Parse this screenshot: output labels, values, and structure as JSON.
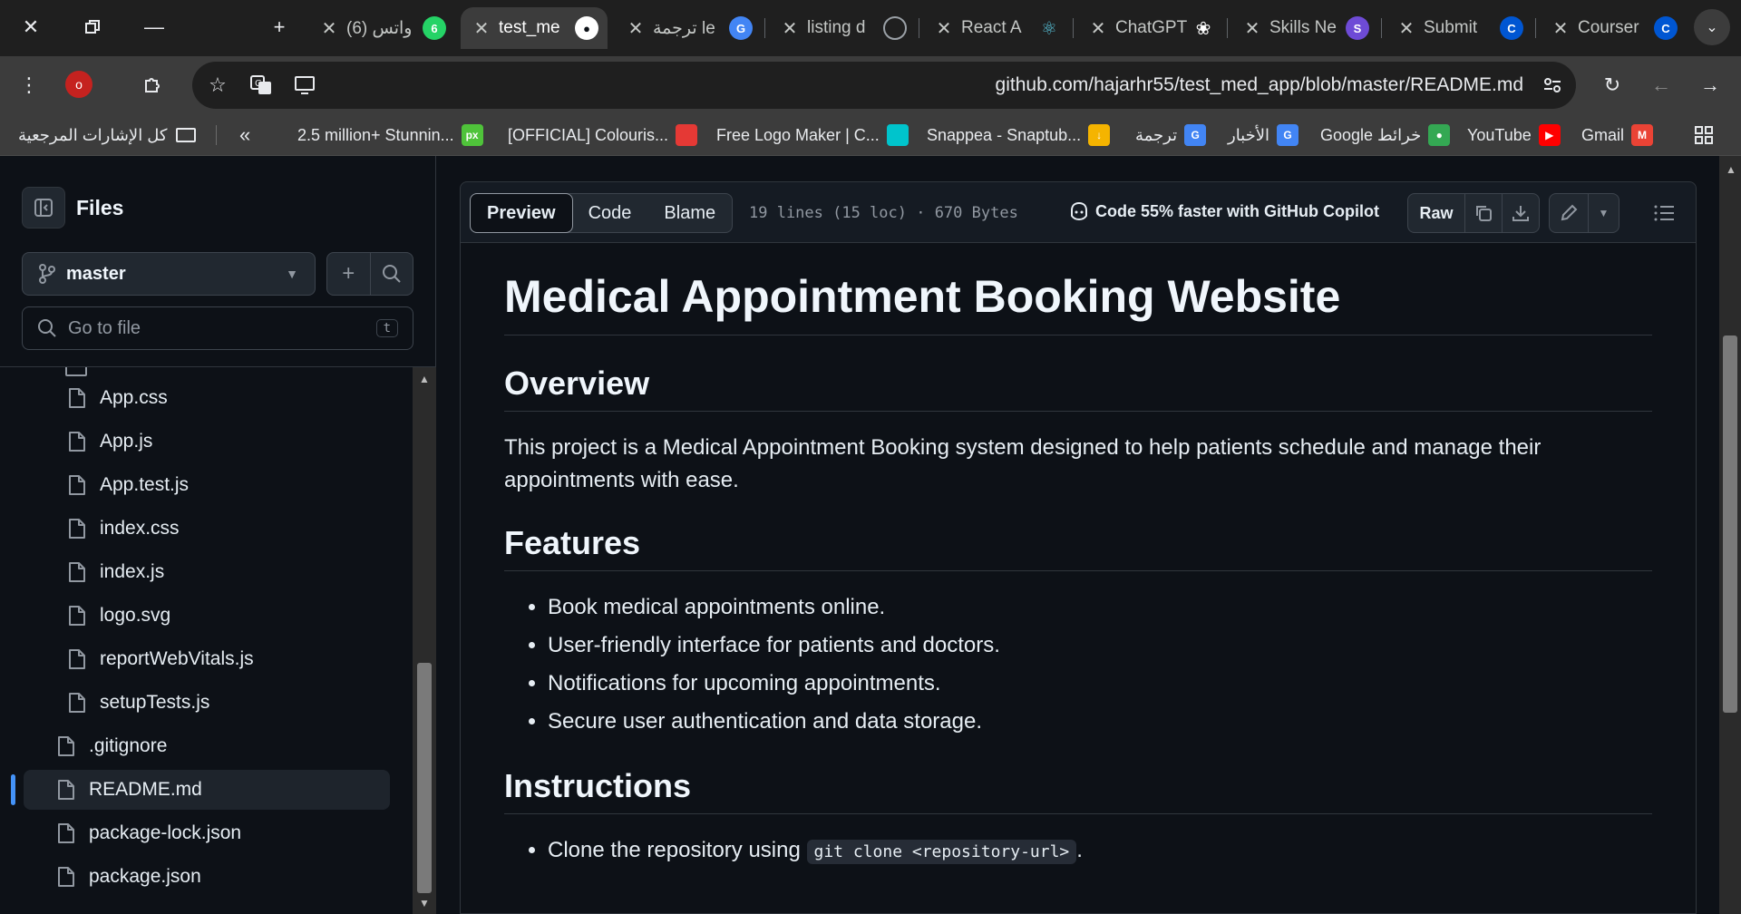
{
  "tabs": [
    {
      "title": "واتس (6)",
      "favicon": "6",
      "color": "#25d366"
    },
    {
      "title": "test_me",
      "favicon": "github",
      "color": "#ffffff",
      "active": true
    },
    {
      "title": "ترجمة le",
      "favicon": "G",
      "color": "#4285f4"
    },
    {
      "title": "listing d",
      "favicon": "globe",
      "color": "#9aa0a6"
    },
    {
      "title": "React A",
      "favicon": "react",
      "color": "#58c4dc"
    },
    {
      "title": "ChatGPT",
      "favicon": "openai",
      "color": "#ffffff"
    },
    {
      "title": "Skills Ne",
      "favicon": "S",
      "color": "#6e4bd6"
    },
    {
      "title": "Submit",
      "favicon": "C",
      "color": "#0056d2"
    },
    {
      "title": "Courser",
      "favicon": "C",
      "color": "#0056d2"
    }
  ],
  "omnibox": {
    "url": "github.com/hajarhr55/test_med_app/blob/master/README.md"
  },
  "profile": {
    "initial": "o"
  },
  "bookmarks": {
    "all_label": "كل الإشارات المرجعية",
    "items": [
      {
        "label": "2.5 million+ Stunnin...",
        "icon": "px",
        "color": "#4fc33a"
      },
      {
        "label": "[OFFICIAL] Colouris...",
        "icon": "",
        "color": "#e53935"
      },
      {
        "label": "Free Logo Maker | C...",
        "icon": "",
        "color": "#00c4cc"
      },
      {
        "label": "Snappea - Snaptub...",
        "icon": "↓",
        "color": "#f5b400"
      },
      {
        "label": "ترجمة",
        "icon": "G",
        "color": "#4285f4"
      },
      {
        "label": "الأخبار",
        "icon": "G",
        "color": "#4285f4"
      },
      {
        "label": "Google خرائط",
        "icon": "●",
        "color": "#34a853"
      },
      {
        "label": "YouTube",
        "icon": "▶",
        "color": "#ff0000"
      },
      {
        "label": "Gmail",
        "icon": "M",
        "color": "#ea4335"
      }
    ]
  },
  "sidebar": {
    "title": "Files",
    "branch": "master",
    "search_placeholder": "Go to file",
    "search_shortcut": "t",
    "files": [
      {
        "name": "App.css",
        "indent": 2
      },
      {
        "name": "App.js",
        "indent": 2
      },
      {
        "name": "App.test.js",
        "indent": 2
      },
      {
        "name": "index.css",
        "indent": 2
      },
      {
        "name": "index.js",
        "indent": 2
      },
      {
        "name": "logo.svg",
        "indent": 2
      },
      {
        "name": "reportWebVitals.js",
        "indent": 2
      },
      {
        "name": "setupTests.js",
        "indent": 2
      },
      {
        "name": ".gitignore",
        "indent": 1
      },
      {
        "name": "README.md",
        "indent": 1,
        "selected": true
      },
      {
        "name": "package-lock.json",
        "indent": 1
      },
      {
        "name": "package.json",
        "indent": 1
      }
    ]
  },
  "file_header": {
    "tabs": [
      "Preview",
      "Code",
      "Blame"
    ],
    "active_tab": "Preview",
    "meta": "19 lines (15 loc) · 670 Bytes",
    "copilot": "Code 55% faster with GitHub Copilot",
    "raw_label": "Raw"
  },
  "readme": {
    "title": "Medical Appointment Booking Website",
    "overview_heading": "Overview",
    "overview_text": "This project is a Medical Appointment Booking system designed to help patients schedule and manage their appointments with ease.",
    "features_heading": "Features",
    "features": [
      "Book medical appointments online.",
      "User-friendly interface for patients and doctors.",
      "Notifications for upcoming appointments.",
      "Secure user authentication and data storage."
    ],
    "instructions_heading": "Instructions",
    "instruction_1_text": "Clone the repository using",
    "instruction_1_code": "git clone <repository-url>",
    "instruction_1_suffix": "."
  }
}
